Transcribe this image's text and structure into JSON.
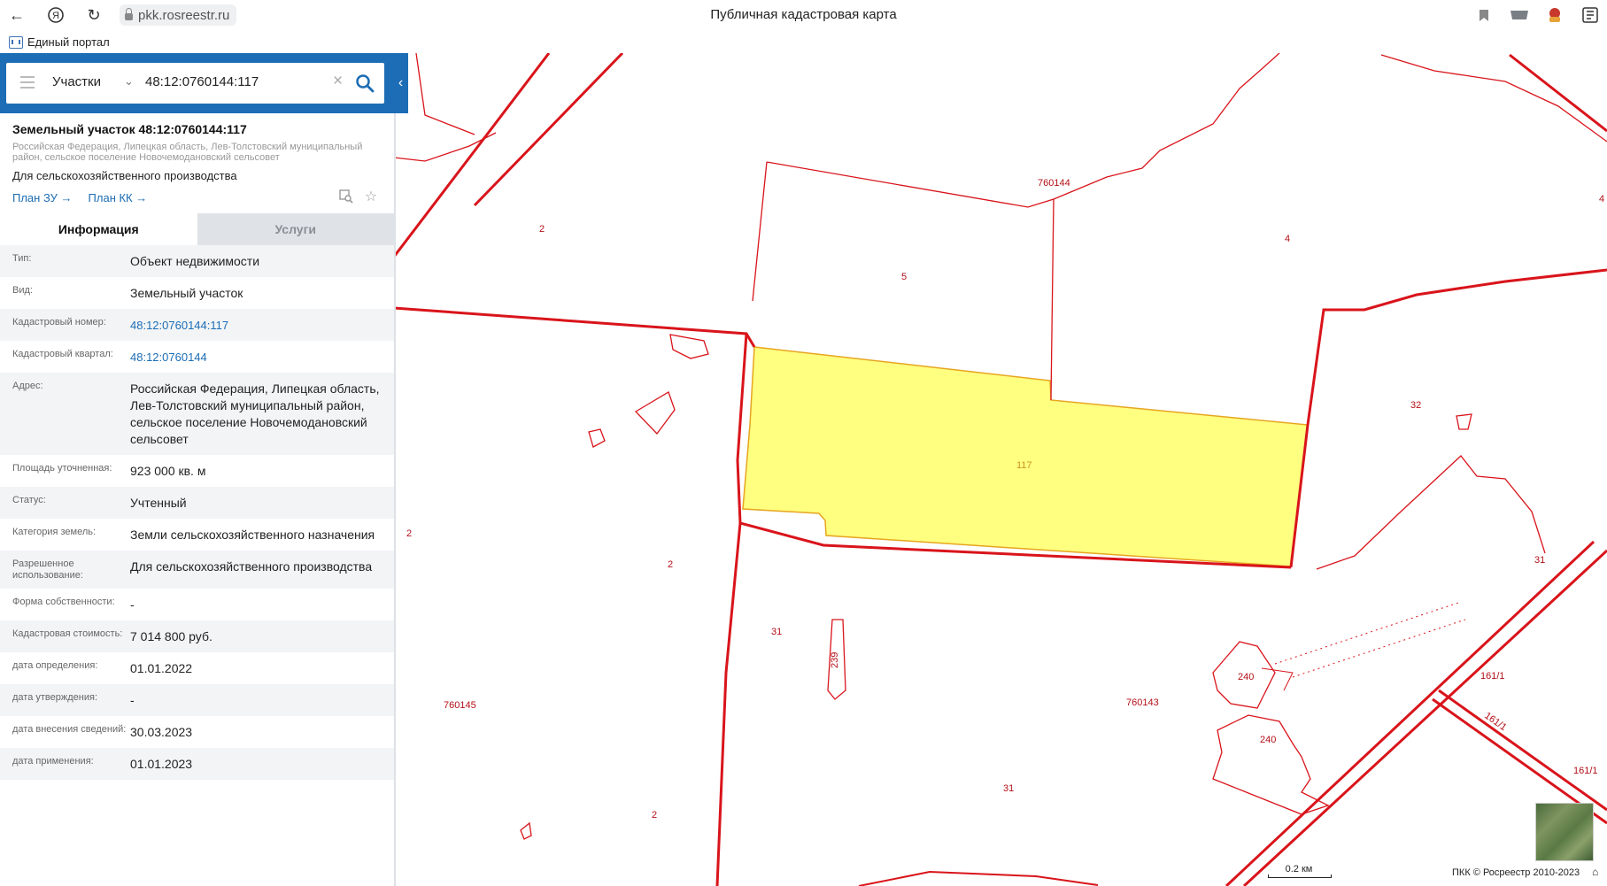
{
  "browser": {
    "url": "pkk.rosreestr.ru",
    "tab_title": "Публичная кадастровая карта",
    "bookmark": "Единый портал"
  },
  "search": {
    "type": "Участки",
    "query": "48:12:0760144:117"
  },
  "object": {
    "title": "Земельный участок 48:12:0760144:117",
    "address": "Российская Федерация, Липецкая область, Лев-Толстовский муниципальный район, сельское поселение Новочемодановский сельсовет",
    "use": "Для сельскохозяйственного производства",
    "plan_zu": "План ЗУ →",
    "plan_kk": "План КК →"
  },
  "tabs": {
    "info": "Информация",
    "services": "Услуги"
  },
  "rows": [
    {
      "label": "Тип:",
      "value": "Объект недвижимости"
    },
    {
      "label": "Вид:",
      "value": "Земельный участок"
    },
    {
      "label": "Кадастровый номер:",
      "value": "48:12:0760144:117"
    },
    {
      "label": "Кадастровый квартал:",
      "value": "48:12:0760144"
    },
    {
      "label": "Адрес:",
      "value": "Российская Федерация, Липецкая область, Лев-Толстовский муниципальный район, сельское поселение Новочемодановский сельсовет"
    },
    {
      "label": "Площадь уточненная:",
      "value": "923 000 кв. м"
    },
    {
      "label": "Статус:",
      "value": "Учтенный"
    },
    {
      "label": "Категория земель:",
      "value": "Земли сельскохозяйственного назначения"
    },
    {
      "label": "Разрешенное использование:",
      "value": "Для сельскохозяйственного производства"
    },
    {
      "label": "Форма собственности:",
      "value": "-"
    },
    {
      "label": "Кадастровая стоимость:",
      "value": "7 014 800 руб."
    },
    {
      "label": "дата определения:",
      "value": "01.01.2022"
    },
    {
      "label": "дата утверждения:",
      "value": "-"
    },
    {
      "label": "дата внесения сведений:",
      "value": "30.03.2023"
    },
    {
      "label": "дата применения:",
      "value": "01.01.2023"
    }
  ],
  "map": {
    "labels": [
      "760144",
      "5",
      "4",
      "2",
      "117",
      "32",
      "2",
      "2",
      "31",
      "31",
      "239",
      "240",
      "240",
      "760143",
      "161/1",
      "161/1",
      "161/1",
      "760145",
      "31",
      "2",
      "4"
    ],
    "scale": "0.2 км",
    "copyright": "ПКК © Росреестр 2010-2023",
    "highlight_color": "#ffff80",
    "line_color": "#d9141b"
  }
}
